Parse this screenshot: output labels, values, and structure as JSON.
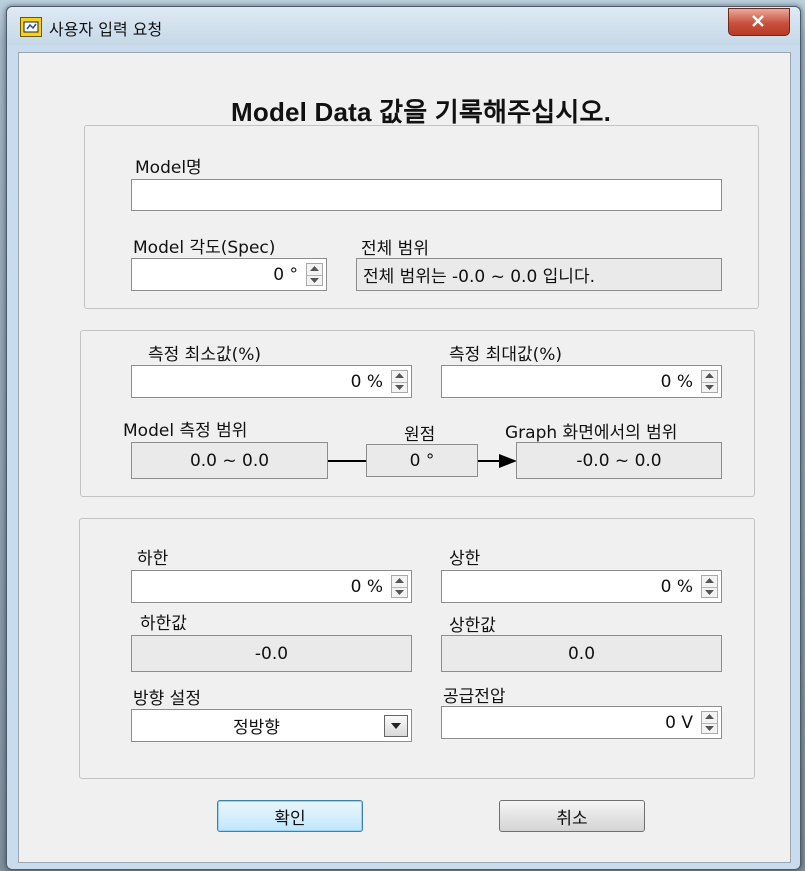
{
  "window": {
    "title": "사용자 입력 요청"
  },
  "heading": "Model Data 값을 기록해주십시오.",
  "model": {
    "name_label": "Model명",
    "name_value": "",
    "angle_label": "Model 각도(Spec)",
    "angle_value": "0 °",
    "range_label": "전체 범위",
    "range_value": "전체 범위는 -0.0 ~ 0.0 입니다."
  },
  "measure": {
    "min_label": "측정 최소값(%)",
    "min_value": "0 %",
    "max_label": "측정 최대값(%)",
    "max_value": "0 %",
    "model_range_label": "Model 측정 범위",
    "model_range_value": "0.0 ~ 0.0",
    "origin_label": "원점",
    "origin_value": "0 °",
    "graph_range_label": "Graph 화면에서의 범위",
    "graph_range_value": "-0.0 ~ 0.0"
  },
  "limits": {
    "lower_label": "하한",
    "lower_value": "0 %",
    "upper_label": "상한",
    "upper_value": "0 %",
    "lower_result_label": "하한값",
    "lower_result_value": "-0.0",
    "upper_result_label": "상한값",
    "upper_result_value": "0.0",
    "direction_label": "방향 설정",
    "direction_value": "정방향",
    "voltage_label": "공급전압",
    "voltage_value": "0 V"
  },
  "buttons": {
    "ok": "확인",
    "cancel": "취소"
  },
  "icons": {
    "app": "labview-icon",
    "close": "close-icon",
    "spin": "spin-arrows-icon",
    "dropdown": "dropdown-arrow-icon"
  },
  "colors": {
    "window_frame": "#c9dced",
    "close_button": "#c9503c",
    "default_button_border": "#3c7fb1"
  }
}
